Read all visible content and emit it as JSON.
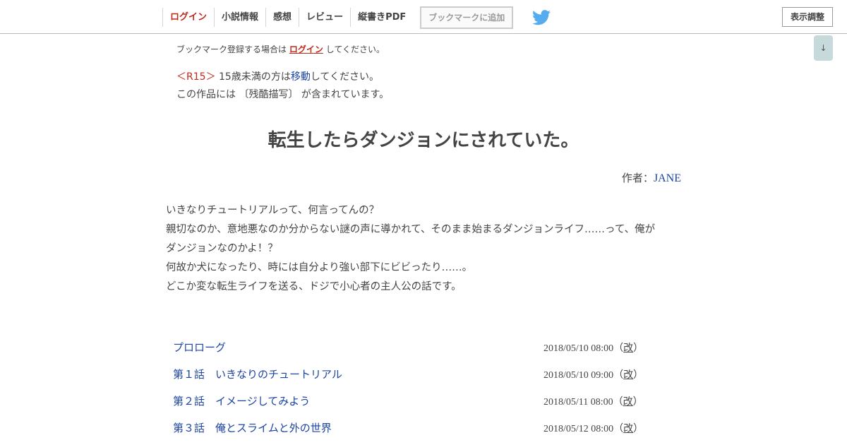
{
  "header": {
    "nav": {
      "login": "ログイン",
      "novel_info": "小説情報",
      "impressions": "感想",
      "review": "レビュー",
      "vertical_pdf": "縦書きPDF"
    },
    "bookmark_button": "ブックマークに追加",
    "twitter_icon": "twitter-bird-icon",
    "display_settings": "表示調整",
    "scroll_down": "↓"
  },
  "notice": {
    "prefix": "ブックマーク登録する場合は",
    "login_link": "ログイン",
    "suffix": "してください。"
  },
  "rating": {
    "label": "＜R15＞",
    "text_before": "15歳未満の方は",
    "move_link": "移動",
    "text_after": "してください。",
    "content_warning": "この作品には 〔残酷描写〕 が含まれています。"
  },
  "novel": {
    "title": "転生したらダンジョンにされていた。",
    "author_label": "作者：",
    "author_name": "JANE",
    "synopsis": [
      "いきなりチュートリアルって、何言ってんの？",
      "親切なのか、意地悪なのか分からない謎の声に導かれて、そのまま始まるダンジョンライフ……って、俺が",
      "ダンジョンなのかよ！？",
      "何故か犬になったり、時には自分より強い部下にビビったり……。",
      "どこか変な転生ライフを送る、ドジで小心者の主人公の話です。"
    ]
  },
  "chapters": [
    {
      "title": "プロローグ",
      "date": "2018/05/10 08:00",
      "revised_open": "（",
      "revised": "改",
      "revised_close": "）"
    },
    {
      "title": "第１話　いきなりのチュートリアル",
      "date": "2018/05/10 09:00",
      "revised_open": "（",
      "revised": "改",
      "revised_close": "）"
    },
    {
      "title": "第２話　イメージしてみよう",
      "date": "2018/05/11 08:00",
      "revised_open": "（",
      "revised": "改",
      "revised_close": "）"
    },
    {
      "title": "第３話　俺とスライムと外の世界",
      "date": "2018/05/12 08:00",
      "revised_open": "（",
      "revised": "改",
      "revised_close": "）"
    }
  ],
  "colors": {
    "accent_red": "#c0281a",
    "link_blue": "#1b44a3",
    "twitter_blue": "#55acee"
  }
}
